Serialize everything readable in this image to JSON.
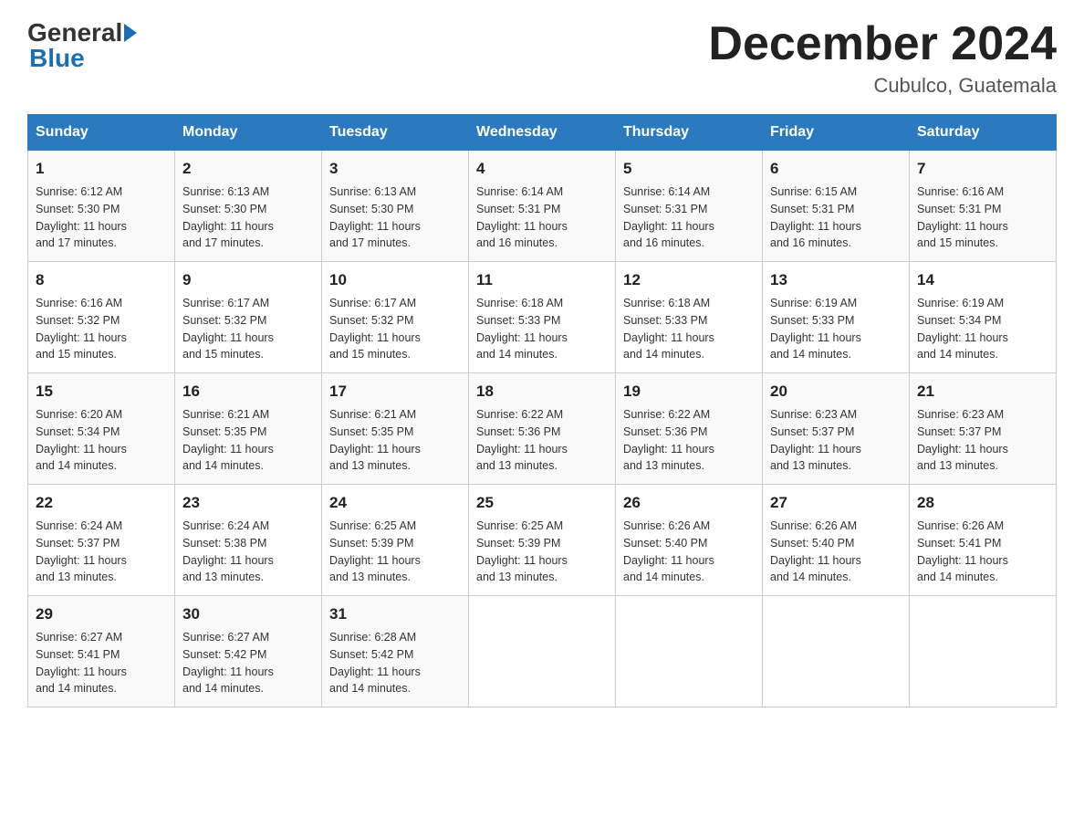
{
  "header": {
    "logo_general": "General",
    "logo_blue": "Blue",
    "month_title": "December 2024",
    "location": "Cubulco, Guatemala"
  },
  "days_of_week": [
    "Sunday",
    "Monday",
    "Tuesday",
    "Wednesday",
    "Thursday",
    "Friday",
    "Saturday"
  ],
  "weeks": [
    [
      {
        "day": "1",
        "sunrise": "6:12 AM",
        "sunset": "5:30 PM",
        "daylight": "11 hours and 17 minutes."
      },
      {
        "day": "2",
        "sunrise": "6:13 AM",
        "sunset": "5:30 PM",
        "daylight": "11 hours and 17 minutes."
      },
      {
        "day": "3",
        "sunrise": "6:13 AM",
        "sunset": "5:30 PM",
        "daylight": "11 hours and 17 minutes."
      },
      {
        "day": "4",
        "sunrise": "6:14 AM",
        "sunset": "5:31 PM",
        "daylight": "11 hours and 16 minutes."
      },
      {
        "day": "5",
        "sunrise": "6:14 AM",
        "sunset": "5:31 PM",
        "daylight": "11 hours and 16 minutes."
      },
      {
        "day": "6",
        "sunrise": "6:15 AM",
        "sunset": "5:31 PM",
        "daylight": "11 hours and 16 minutes."
      },
      {
        "day": "7",
        "sunrise": "6:16 AM",
        "sunset": "5:31 PM",
        "daylight": "11 hours and 15 minutes."
      }
    ],
    [
      {
        "day": "8",
        "sunrise": "6:16 AM",
        "sunset": "5:32 PM",
        "daylight": "11 hours and 15 minutes."
      },
      {
        "day": "9",
        "sunrise": "6:17 AM",
        "sunset": "5:32 PM",
        "daylight": "11 hours and 15 minutes."
      },
      {
        "day": "10",
        "sunrise": "6:17 AM",
        "sunset": "5:32 PM",
        "daylight": "11 hours and 15 minutes."
      },
      {
        "day": "11",
        "sunrise": "6:18 AM",
        "sunset": "5:33 PM",
        "daylight": "11 hours and 14 minutes."
      },
      {
        "day": "12",
        "sunrise": "6:18 AM",
        "sunset": "5:33 PM",
        "daylight": "11 hours and 14 minutes."
      },
      {
        "day": "13",
        "sunrise": "6:19 AM",
        "sunset": "5:33 PM",
        "daylight": "11 hours and 14 minutes."
      },
      {
        "day": "14",
        "sunrise": "6:19 AM",
        "sunset": "5:34 PM",
        "daylight": "11 hours and 14 minutes."
      }
    ],
    [
      {
        "day": "15",
        "sunrise": "6:20 AM",
        "sunset": "5:34 PM",
        "daylight": "11 hours and 14 minutes."
      },
      {
        "day": "16",
        "sunrise": "6:21 AM",
        "sunset": "5:35 PM",
        "daylight": "11 hours and 14 minutes."
      },
      {
        "day": "17",
        "sunrise": "6:21 AM",
        "sunset": "5:35 PM",
        "daylight": "11 hours and 13 minutes."
      },
      {
        "day": "18",
        "sunrise": "6:22 AM",
        "sunset": "5:36 PM",
        "daylight": "11 hours and 13 minutes."
      },
      {
        "day": "19",
        "sunrise": "6:22 AM",
        "sunset": "5:36 PM",
        "daylight": "11 hours and 13 minutes."
      },
      {
        "day": "20",
        "sunrise": "6:23 AM",
        "sunset": "5:37 PM",
        "daylight": "11 hours and 13 minutes."
      },
      {
        "day": "21",
        "sunrise": "6:23 AM",
        "sunset": "5:37 PM",
        "daylight": "11 hours and 13 minutes."
      }
    ],
    [
      {
        "day": "22",
        "sunrise": "6:24 AM",
        "sunset": "5:37 PM",
        "daylight": "11 hours and 13 minutes."
      },
      {
        "day": "23",
        "sunrise": "6:24 AM",
        "sunset": "5:38 PM",
        "daylight": "11 hours and 13 minutes."
      },
      {
        "day": "24",
        "sunrise": "6:25 AM",
        "sunset": "5:39 PM",
        "daylight": "11 hours and 13 minutes."
      },
      {
        "day": "25",
        "sunrise": "6:25 AM",
        "sunset": "5:39 PM",
        "daylight": "11 hours and 13 minutes."
      },
      {
        "day": "26",
        "sunrise": "6:26 AM",
        "sunset": "5:40 PM",
        "daylight": "11 hours and 14 minutes."
      },
      {
        "day": "27",
        "sunrise": "6:26 AM",
        "sunset": "5:40 PM",
        "daylight": "11 hours and 14 minutes."
      },
      {
        "day": "28",
        "sunrise": "6:26 AM",
        "sunset": "5:41 PM",
        "daylight": "11 hours and 14 minutes."
      }
    ],
    [
      {
        "day": "29",
        "sunrise": "6:27 AM",
        "sunset": "5:41 PM",
        "daylight": "11 hours and 14 minutes."
      },
      {
        "day": "30",
        "sunrise": "6:27 AM",
        "sunset": "5:42 PM",
        "daylight": "11 hours and 14 minutes."
      },
      {
        "day": "31",
        "sunrise": "6:28 AM",
        "sunset": "5:42 PM",
        "daylight": "11 hours and 14 minutes."
      },
      null,
      null,
      null,
      null
    ]
  ],
  "labels": {
    "sunrise": "Sunrise:",
    "sunset": "Sunset:",
    "daylight": "Daylight:"
  }
}
